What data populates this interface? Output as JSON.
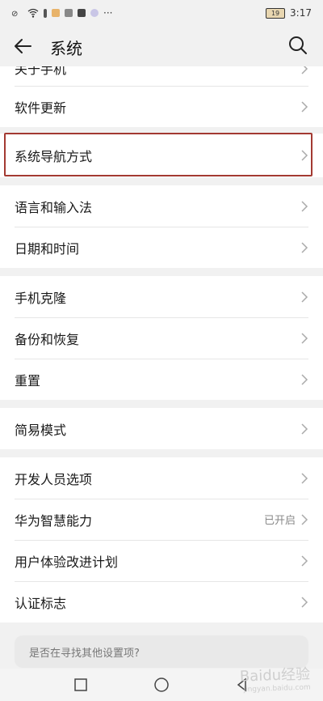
{
  "status_bar": {
    "time": "3:17",
    "battery": "19"
  },
  "header": {
    "title": "系统"
  },
  "partial_row": {
    "label": "关于手机"
  },
  "groups": [
    [
      {
        "label": "软件更新"
      },
      {
        "label": "系统导航方式"
      }
    ],
    [
      {
        "label": "语言和输入法"
      },
      {
        "label": "日期和时间"
      }
    ],
    [
      {
        "label": "手机克隆"
      },
      {
        "label": "备份和恢复"
      },
      {
        "label": "重置"
      }
    ],
    [
      {
        "label": "简易模式"
      }
    ],
    [
      {
        "label": "开发人员选项"
      },
      {
        "label": "华为智慧能力",
        "value": "已开启"
      },
      {
        "label": "用户体验改进计划"
      },
      {
        "label": "认证标志"
      }
    ]
  ],
  "suggestion": {
    "text": "是否在寻找其他设置项?"
  },
  "watermark": {
    "text": "Baidu经验",
    "sub": "jingyan.baidu.com"
  }
}
